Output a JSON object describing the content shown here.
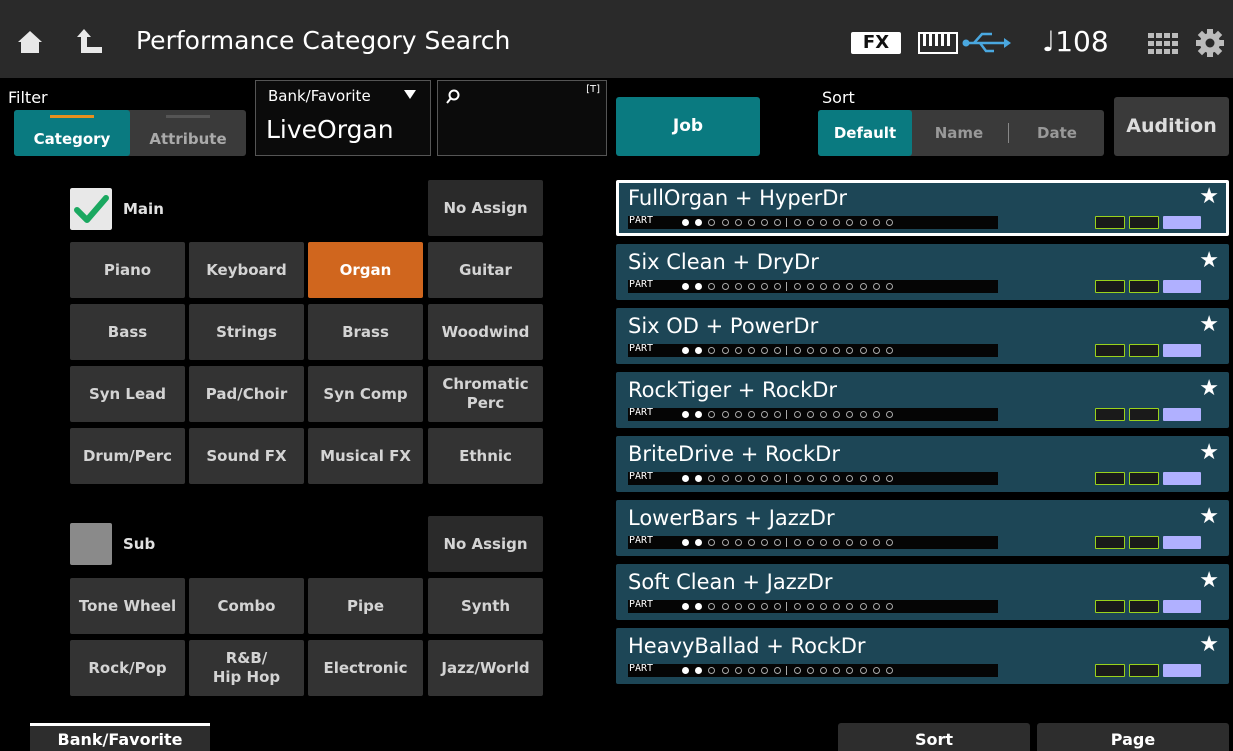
{
  "header": {
    "title": "Performance Category Search",
    "fx_label": "FX",
    "tempo": "♩108",
    "icons": [
      "home-icon",
      "up-arrow-icon",
      "keyboard-icon",
      "usb-icon",
      "grid-icon",
      "gear-icon"
    ]
  },
  "filter": {
    "label": "Filter",
    "category_label": "Category",
    "attribute_label": "Attribute",
    "selected": "Category"
  },
  "bank": {
    "label": "Bank/Favorite",
    "value": "LiveOrgan"
  },
  "search": {
    "text_mode_label": "[T]",
    "value": ""
  },
  "job_label": "Job",
  "sort": {
    "label": "Sort",
    "options": [
      "Default",
      "Name",
      "Date"
    ],
    "selected": "Default"
  },
  "audition_label": "Audition",
  "main": {
    "label": "Main",
    "checked": true,
    "no_assign": "No Assign",
    "categories": [
      "Piano",
      "Keyboard",
      "Organ",
      "Guitar",
      "Bass",
      "Strings",
      "Brass",
      "Woodwind",
      "Syn Lead",
      "Pad/Choir",
      "Syn Comp",
      "Chromatic\nPerc",
      "Drum/Perc",
      "Sound FX",
      "Musical FX",
      "Ethnic"
    ],
    "selected": "Organ"
  },
  "sub": {
    "label": "Sub",
    "checked": false,
    "no_assign": "No Assign",
    "categories": [
      "Tone Wheel",
      "Combo",
      "Pipe",
      "Synth",
      "Rock/Pop",
      "R&B/\nHip Hop",
      "Electronic",
      "Jazz/World"
    ]
  },
  "performances": [
    {
      "name": "FullOrgan + HyperDr",
      "part_label": "PART",
      "selected": true
    },
    {
      "name": "Six Clean + DryDr",
      "part_label": "PART",
      "selected": false
    },
    {
      "name": "Six OD + PowerDr",
      "part_label": "PART",
      "selected": false
    },
    {
      "name": "RockTiger + RockDr",
      "part_label": "PART",
      "selected": false
    },
    {
      "name": "BriteDrive + RockDr",
      "part_label": "PART",
      "selected": false
    },
    {
      "name": "LowerBars + JazzDr",
      "part_label": "PART",
      "selected": false
    },
    {
      "name": "Soft Clean + JazzDr",
      "part_label": "PART",
      "selected": false
    },
    {
      "name": "HeavyBallad + RockDr",
      "part_label": "PART",
      "selected": false
    }
  ],
  "bottom_tabs": {
    "bank_favorite": "Bank/Favorite",
    "sort": "Sort",
    "page": "Page"
  },
  "colors": {
    "accent_teal": "#0a7a80",
    "active_orange": "#d0661e",
    "row_blue": "#1d4656",
    "check_green": "#1aa860"
  }
}
